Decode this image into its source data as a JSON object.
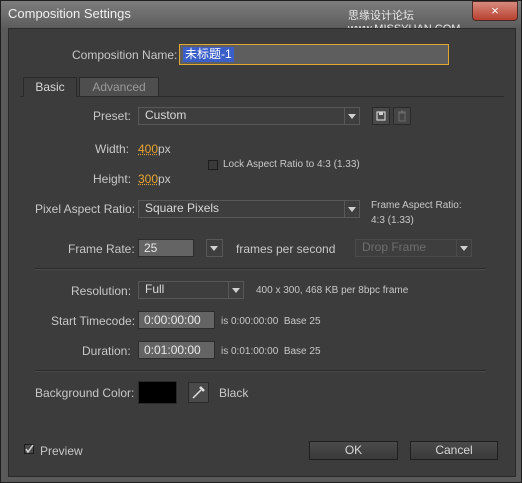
{
  "window": {
    "title": "Composition Settings",
    "watermark": "思缘设计论坛 www.MISSYUAN.COM",
    "close_glyph": "×"
  },
  "comp_name": {
    "label": "Composition Name:",
    "value": "未标题-1"
  },
  "tabs": [
    {
      "label": "Basic"
    },
    {
      "label": "Advanced"
    }
  ],
  "preset": {
    "label": "Preset:",
    "value": "Custom"
  },
  "width": {
    "label": "Width:",
    "value": "400",
    "unit": "px"
  },
  "height": {
    "label": "Height:",
    "value": "300",
    "unit": "px"
  },
  "lock_aspect": {
    "label": "Lock Aspect Ratio to 4:3 (1.33)",
    "checked": false
  },
  "pixel_aspect": {
    "label": "Pixel Aspect Ratio:",
    "value": "Square Pixels"
  },
  "frame_aspect": {
    "label": "Frame Aspect Ratio:",
    "value": "4:3 (1.33)"
  },
  "frame_rate": {
    "label": "Frame Rate:",
    "value": "25",
    "unit": "frames per second",
    "drop_frame": "Drop Frame"
  },
  "resolution": {
    "label": "Resolution:",
    "value": "Full",
    "info": "400 x 300, 468 KB per 8bpc frame"
  },
  "start_timecode": {
    "label": "Start Timecode:",
    "value": "0:00:00:00",
    "info": "is 0:00:00:00  Base 25"
  },
  "duration": {
    "label": "Duration:",
    "value": "0:01:00:00",
    "info": "is 0:01:00:00  Base 25"
  },
  "background": {
    "label": "Background Color:",
    "color": "#000000",
    "name": "Black"
  },
  "preview": {
    "label": "Preview",
    "checked": true
  },
  "buttons": {
    "ok": "OK",
    "cancel": "Cancel"
  },
  "colors": {
    "accent": "#e8a330",
    "name_field": "#3a5fc8",
    "name_border": "#e0a832"
  }
}
